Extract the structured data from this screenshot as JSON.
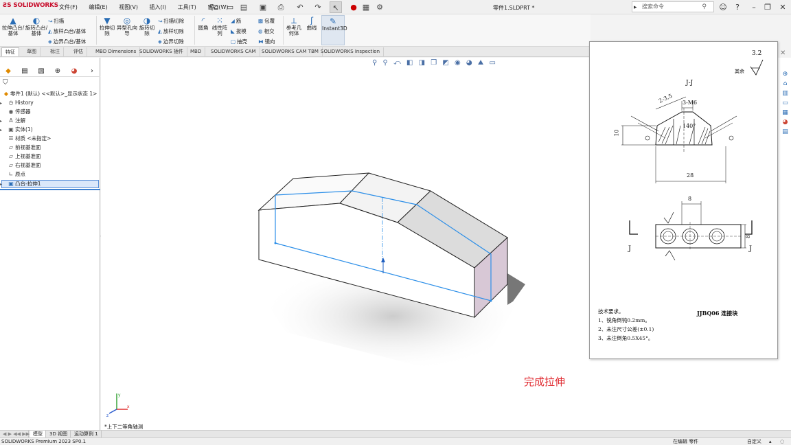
{
  "app": {
    "logo": "SOLIDWORKS",
    "document_title": "零件1.SLDPRT *"
  },
  "menus": [
    "文件(F)",
    "编辑(E)",
    "视图(V)",
    "插入(I)",
    "工具(T)",
    "窗口(W)"
  ],
  "search": {
    "placeholder": "搜索命令"
  },
  "ribbon": {
    "extrude_boss": "拉伸凸台/基体",
    "revolve_boss": "旋转凸台/基体",
    "sweep": "扫描",
    "loft": "放样凸台/基体",
    "boundary": "边界凸台/基体",
    "extrude_cut": "拉伸切除",
    "hole_wizard": "异型孔向导",
    "revolve_cut": "旋转切除",
    "swept_cut": "扫描切除",
    "lofted_cut": "放样切除",
    "boundary_cut": "边界切除",
    "fillet": "圆角",
    "linear_pattern": "线性阵列",
    "rib": "筋",
    "draft": "拔模",
    "shell": "抽壳",
    "wrap": "包覆",
    "intersect": "相交",
    "mirror": "镜向",
    "ref_geometry": "参考几何体",
    "curves": "曲线",
    "instant3d": "Instant3D"
  },
  "cmd_tabs": [
    "特征",
    "草图",
    "标注",
    "评估",
    "MBD Dimensions",
    "SOLIDWORKS 插件",
    "MBD",
    "SOLIDWORKS CAM",
    "SOLIDWORKS CAM TBM",
    "SOLIDWORKS Inspection"
  ],
  "tree": {
    "root": "零件1 (默认) <<默认>_显示状态 1>",
    "items": [
      "History",
      "传感器",
      "注解",
      "实体(1)",
      "材质 <未指定>",
      "前视基准面",
      "上视基准面",
      "右视基准面",
      "原点",
      "凸台-拉伸1"
    ]
  },
  "viewport": {
    "view_name": "*上下二等角轴测",
    "caption": "完成拉伸"
  },
  "drawing": {
    "roughness": "3.2",
    "roughness_note": "其余",
    "section": "J-J",
    "dim_chamfer": "2-3.5",
    "dim_thread": "3-M6",
    "dim_angle": "140°",
    "dim_height": "10",
    "dim_width": "28",
    "dim_8_top": "8",
    "dim_8_side": "8",
    "label_j_left": "J",
    "label_j_right": "J",
    "tech_title": "技术要求。",
    "tech_lines": [
      "1、锐角倒钝0.2mm。",
      "2、未注尺寸公差(±0.1)",
      "3、未注倒角0.5X45°。"
    ],
    "part_name": "JJBQ06 连接块"
  },
  "bottom_tabs": [
    "模型",
    "3D 视图",
    "运动算例 1"
  ],
  "status": {
    "product": "SOLIDWORKS Premium 2023 SP0.1",
    "editing": "在编辑 零件",
    "custom": "自定义"
  }
}
